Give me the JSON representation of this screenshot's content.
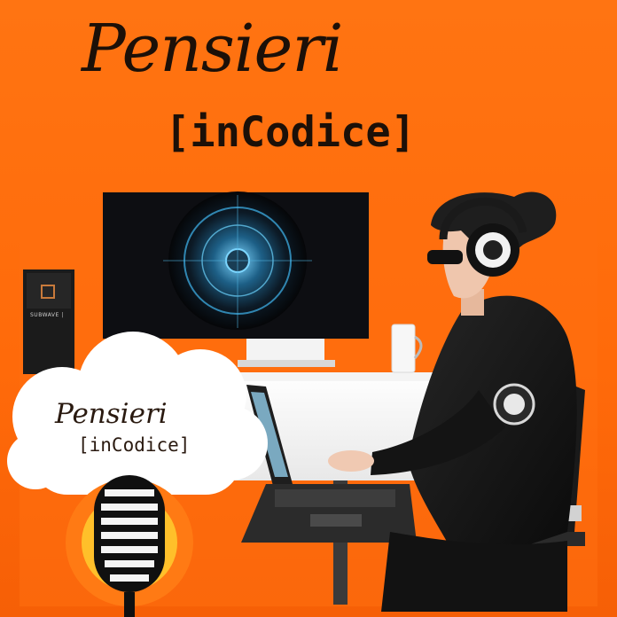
{
  "header": {
    "title_script": "Pensieri",
    "title_mono": "[inCodice]"
  },
  "badge": {
    "title_script": "Pensieri",
    "title_mono": "[inCodice]"
  },
  "device_label": "SUBWAVE |",
  "icons": {
    "microphone": "microphone-icon",
    "headphones": "headphones-icon"
  },
  "colors": {
    "background": "#ff6d0d",
    "text": "#1c1008",
    "cloud": "#ffffff",
    "mic_circle": "#ffc02a",
    "hoodie": "#161616"
  }
}
